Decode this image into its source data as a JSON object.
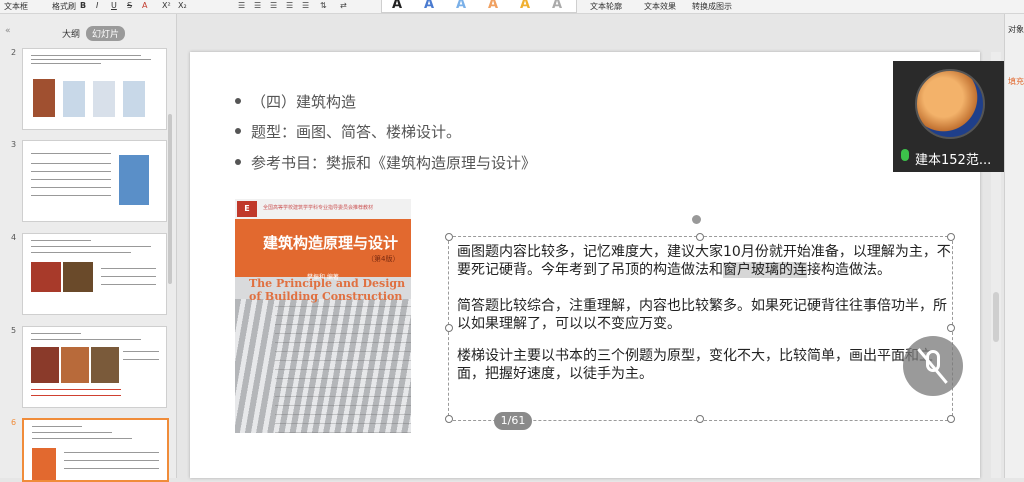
{
  "ribbon": {
    "items": [
      "文本框",
      "格式刷",
      "B",
      "I",
      "U",
      "S",
      "A",
      "X²",
      "X₂",
      "文本轮廓",
      "文本效果",
      "转换成图示"
    ],
    "style_letters": [
      "A",
      "A",
      "A",
      "A",
      "A",
      "A"
    ]
  },
  "left_panel": {
    "tabs": [
      "大纲",
      "幻灯片"
    ],
    "active_tab": "幻灯片",
    "collapse_icon": "«",
    "thumbnails": [
      {
        "num": "2",
        "selected": false
      },
      {
        "num": "3",
        "selected": false
      },
      {
        "num": "4",
        "selected": false
      },
      {
        "num": "5",
        "selected": false
      },
      {
        "num": "6",
        "selected": true
      }
    ]
  },
  "slide": {
    "bullets": [
      "（四）建筑构造",
      "题型：画图、简答、楼梯设计。",
      "参考书目：樊振和《建筑构造原理与设计》"
    ],
    "book": {
      "tag": "E",
      "top_text": "全国高等学校建筑学学科专业指导委员会推荐教材",
      "title": "建筑构造原理与设计",
      "edition": "（第4版）",
      "author": "樊振和 编著",
      "english": "The Principle and Design of Building Construction"
    },
    "paragraphs": [
      {
        "before": "画图题内容比较多，记忆难度大，建议大家10月份就开始准备，以理解为主，不要死记硬背。今年考到了吊顶的构造做法和",
        "highlight": "窗户玻璃的连",
        "after": "接构造做法。"
      },
      {
        "before": "简答题比较综合，注重理解，内容也比较繁多。如果死记硬背往往事倍功半，所以如果理解了，可以以不变应万变。",
        "highlight": "",
        "after": ""
      },
      {
        "before": "楼梯设计主要以书本的三个例题为原型，变化不大，比较简单，画出平面和立面，把握好速度，以徒手为主。",
        "highlight": "",
        "after": ""
      }
    ]
  },
  "page_indicator": "1/61",
  "video": {
    "name": "建本152范..."
  },
  "right_panel": {
    "label1": "对象属性",
    "label2": "填充"
  },
  "colors": {
    "accent": "#f08c3a",
    "book_orange": "#e2692f",
    "mic_green": "#3cc24a"
  }
}
